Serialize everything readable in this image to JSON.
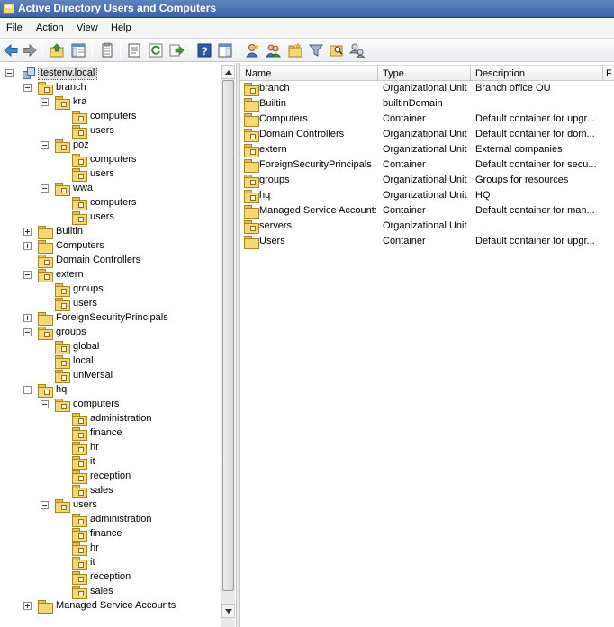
{
  "window": {
    "title": "Active Directory Users and Computers"
  },
  "menubar": {
    "items": [
      "File",
      "Action",
      "View",
      "Help"
    ]
  },
  "toolbar": {
    "icons": [
      "back-icon",
      "forward-icon",
      "up-folder-icon",
      "show-hide-tree-icon",
      "copy-icon",
      "properties-icon",
      "refresh-icon",
      "export-list-icon",
      "help-icon",
      "console-icon",
      "new-user-icon",
      "new-group-icon",
      "new-ou-icon",
      "filter-icon",
      "find-icon",
      "delegate-icon"
    ]
  },
  "tree": {
    "root": "testenv.local",
    "nodes": [
      {
        "label": "branch",
        "level": 1,
        "expander": "minus",
        "ou": true
      },
      {
        "label": "kra",
        "level": 2,
        "expander": "minus",
        "ou": true
      },
      {
        "label": "computers",
        "level": 3,
        "expander": "none",
        "ou": true
      },
      {
        "label": "users",
        "level": 3,
        "expander": "none",
        "ou": true
      },
      {
        "label": "poz",
        "level": 2,
        "expander": "minus",
        "ou": true
      },
      {
        "label": "computers",
        "level": 3,
        "expander": "none",
        "ou": true
      },
      {
        "label": "users",
        "level": 3,
        "expander": "none",
        "ou": true
      },
      {
        "label": "wwa",
        "level": 2,
        "expander": "minus",
        "ou": true
      },
      {
        "label": "computers",
        "level": 3,
        "expander": "none",
        "ou": true
      },
      {
        "label": "users",
        "level": 3,
        "expander": "none",
        "ou": true
      },
      {
        "label": "Builtin",
        "level": 1,
        "expander": "plus",
        "ou": false
      },
      {
        "label": "Computers",
        "level": 1,
        "expander": "plus",
        "ou": false
      },
      {
        "label": "Domain Controllers",
        "level": 1,
        "expander": "none",
        "ou": true
      },
      {
        "label": "extern",
        "level": 1,
        "expander": "minus",
        "ou": true
      },
      {
        "label": "groups",
        "level": 2,
        "expander": "none",
        "ou": true
      },
      {
        "label": "users",
        "level": 2,
        "expander": "none",
        "ou": true
      },
      {
        "label": "ForeignSecurityPrincipals",
        "level": 1,
        "expander": "plus",
        "ou": false
      },
      {
        "label": "groups",
        "level": 1,
        "expander": "minus",
        "ou": true
      },
      {
        "label": "global",
        "level": 2,
        "expander": "none",
        "ou": true
      },
      {
        "label": "local",
        "level": 2,
        "expander": "none",
        "ou": true
      },
      {
        "label": "universal",
        "level": 2,
        "expander": "none",
        "ou": true
      },
      {
        "label": "hq",
        "level": 1,
        "expander": "minus",
        "ou": true
      },
      {
        "label": "computers",
        "level": 2,
        "expander": "minus",
        "ou": true
      },
      {
        "label": "administration",
        "level": 3,
        "expander": "none",
        "ou": true
      },
      {
        "label": "finance",
        "level": 3,
        "expander": "none",
        "ou": true
      },
      {
        "label": "hr",
        "level": 3,
        "expander": "none",
        "ou": true
      },
      {
        "label": "it",
        "level": 3,
        "expander": "none",
        "ou": true
      },
      {
        "label": "reception",
        "level": 3,
        "expander": "none",
        "ou": true
      },
      {
        "label": "sales",
        "level": 3,
        "expander": "none",
        "ou": true
      },
      {
        "label": "users",
        "level": 2,
        "expander": "minus",
        "ou": true
      },
      {
        "label": "administration",
        "level": 3,
        "expander": "none",
        "ou": true
      },
      {
        "label": "finance",
        "level": 3,
        "expander": "none",
        "ou": true
      },
      {
        "label": "hr",
        "level": 3,
        "expander": "none",
        "ou": true
      },
      {
        "label": "it",
        "level": 3,
        "expander": "none",
        "ou": true
      },
      {
        "label": "reception",
        "level": 3,
        "expander": "none",
        "ou": true
      },
      {
        "label": "sales",
        "level": 3,
        "expander": "none",
        "ou": true
      },
      {
        "label": "Managed Service Accounts",
        "level": 1,
        "expander": "plus",
        "ou": false
      }
    ]
  },
  "list": {
    "columns": [
      "Name",
      "Type",
      "Description",
      "F"
    ],
    "rows": [
      {
        "name": "branch",
        "type": "Organizational Unit",
        "description": "Branch office OU",
        "ou": true
      },
      {
        "name": "Builtin",
        "type": "builtinDomain",
        "description": "",
        "ou": false
      },
      {
        "name": "Computers",
        "type": "Container",
        "description": "Default container for upgr...",
        "ou": false
      },
      {
        "name": "Domain Controllers",
        "type": "Organizational Unit",
        "description": "Default container for dom...",
        "ou": true
      },
      {
        "name": "extern",
        "type": "Organizational Unit",
        "description": "External companies",
        "ou": true
      },
      {
        "name": "ForeignSecurityPrincipals",
        "type": "Container",
        "description": "Default container for secu...",
        "ou": false
      },
      {
        "name": "groups",
        "type": "Organizational Unit",
        "description": "Groups for resources",
        "ou": true
      },
      {
        "name": "hq",
        "type": "Organizational Unit",
        "description": "HQ",
        "ou": true
      },
      {
        "name": "Managed Service Accounts",
        "type": "Container",
        "description": "Default container for man...",
        "ou": false
      },
      {
        "name": "servers",
        "type": "Organizational Unit",
        "description": "",
        "ou": true
      },
      {
        "name": "Users",
        "type": "Container",
        "description": "Default container for upgr...",
        "ou": false
      }
    ]
  }
}
